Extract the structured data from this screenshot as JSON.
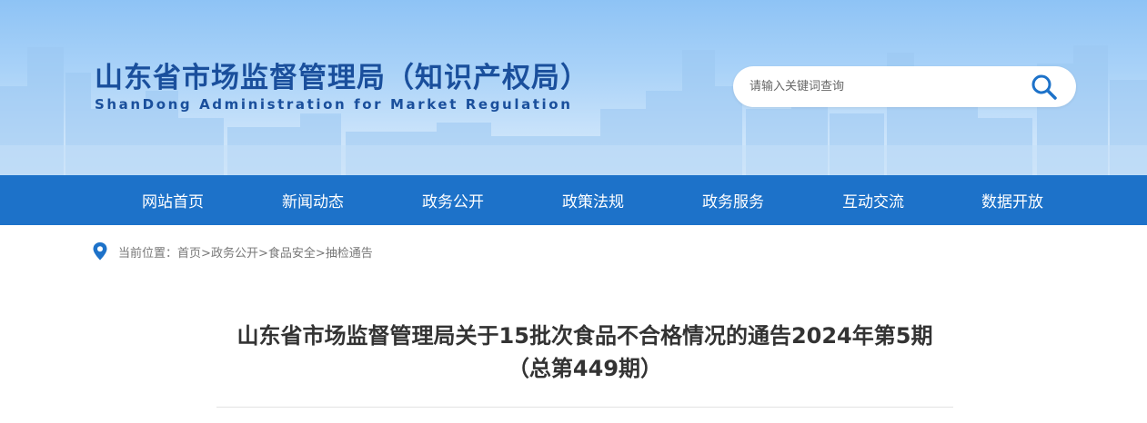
{
  "header": {
    "title": "山东省市场监督管理局（知识产权局）",
    "subtitle": "ShanDong Administration for Market Regulation",
    "search": {
      "placeholder": "请输入关键词查询",
      "icon": "search-icon"
    }
  },
  "colors": {
    "nav_bg": "#1d72c9",
    "title_blue": "#1a4f9c",
    "banner_sky": "#a9d2f8",
    "search_icon": "#1d72c9"
  },
  "nav": {
    "items": [
      {
        "label": "网站首页"
      },
      {
        "label": "新闻动态"
      },
      {
        "label": "政务公开"
      },
      {
        "label": "政策法规"
      },
      {
        "label": "政务服务"
      },
      {
        "label": "互动交流"
      },
      {
        "label": "数据开放"
      }
    ]
  },
  "breadcrumb": {
    "icon": "location-pin-icon",
    "prefix": "当前位置：",
    "items": [
      "首页",
      "政务公开",
      "食品安全",
      "抽检通告"
    ],
    "separator": ">"
  },
  "article": {
    "title": "山东省市场监督管理局关于15批次食品不合格情况的通告2024年第5期（总第449期）"
  }
}
